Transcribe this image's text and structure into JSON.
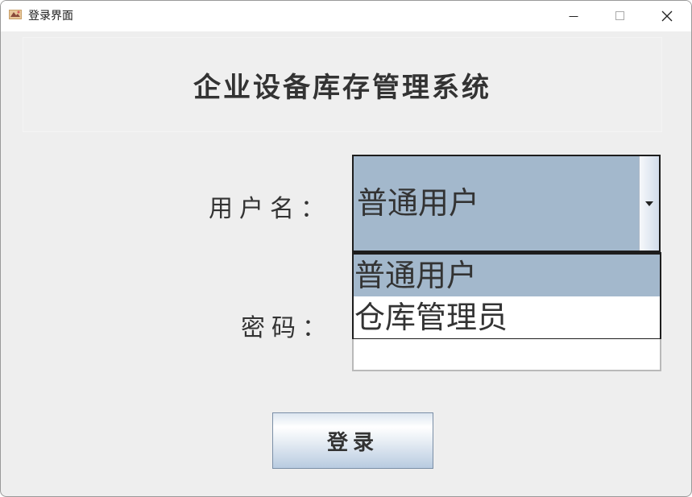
{
  "window": {
    "title": "登录界面",
    "minimize_glyph": "—",
    "maximize_glyph": "☐",
    "close_glyph": "✕"
  },
  "header": {
    "title": "企业设备库存管理系统"
  },
  "form": {
    "username_label": "用户名：",
    "password_label": "密码：",
    "user_type_combo": {
      "selected": "普通用户",
      "options": [
        "普通用户",
        "仓库管理员"
      ],
      "highlighted_index": 0,
      "expanded": true
    },
    "password_value": ""
  },
  "buttons": {
    "login_label": "登录"
  },
  "colors": {
    "window_bg": "#eeeeee",
    "selection": "#a3b8cc",
    "text": "#333333",
    "border_dark": "#1d1d1d"
  }
}
